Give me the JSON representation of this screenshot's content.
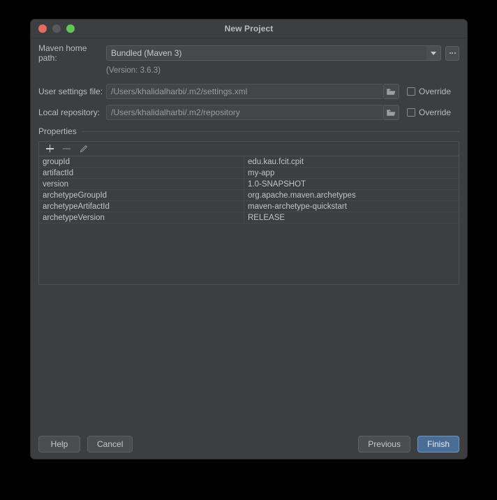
{
  "window": {
    "title": "New Project",
    "traffic_lights": [
      "close-light",
      "minimize-light",
      "zoom-light"
    ]
  },
  "form": {
    "maven_home": {
      "label": "Maven home path:",
      "value": "Bundled (Maven 3)",
      "dropdown_icon": "chevron-down-icon",
      "browse_label": "...",
      "version_note": "(Version: 3.6.3)"
    },
    "user_settings": {
      "label": "User settings file:",
      "value": "/Users/khalidalharbi/.m2/settings.xml",
      "folder_icon": "folder-icon",
      "override_label": "Override",
      "override_checked": false
    },
    "local_repository": {
      "label": "Local repository:",
      "value": "/Users/khalidalharbi/.m2/repository",
      "folder_icon": "folder-icon",
      "override_label": "Override",
      "override_checked": false
    }
  },
  "properties": {
    "title": "Properties",
    "toolbar": {
      "add_icon": "plus-icon",
      "remove_icon": "minus-icon",
      "edit_icon": "pencil-icon"
    },
    "rows": [
      {
        "key": "groupId",
        "value": "edu.kau.fcit.cpit"
      },
      {
        "key": "artifactId",
        "value": "my-app"
      },
      {
        "key": "version",
        "value": "1.0-SNAPSHOT"
      },
      {
        "key": "archetypeGroupId",
        "value": "org.apache.maven.archetypes"
      },
      {
        "key": "archetypeArtifactId",
        "value": "maven-archetype-quickstart"
      },
      {
        "key": "archetypeVersion",
        "value": "RELEASE"
      }
    ]
  },
  "footer": {
    "help_label": "Help",
    "cancel_label": "Cancel",
    "previous_label": "Previous",
    "finish_label": "Finish"
  },
  "colors": {
    "window_bg": "#3c3f41",
    "field_bg": "#45494a",
    "text": "#bbbbbb",
    "primary_button": "#4a6d96",
    "close_light": "#e8695f",
    "minimize_light": "#57595b",
    "zoom_light": "#62c554"
  }
}
